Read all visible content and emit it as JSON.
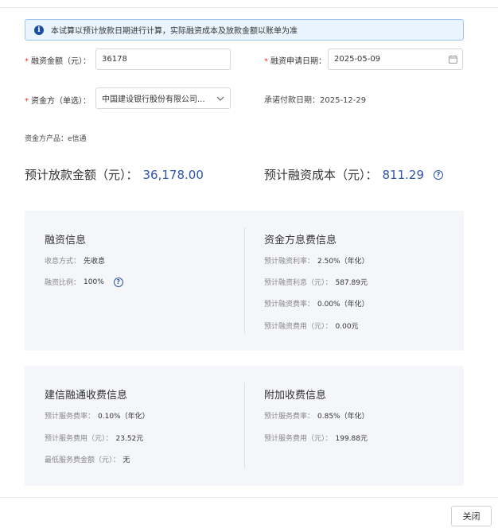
{
  "alert": {
    "text": "本试算以预计放款日期进行计算，实际融资成本及放款金额以账单为准"
  },
  "form": {
    "amount_label": "融资金额（元）：",
    "amount_value": "36178",
    "apply_date_label": "融资申请日期：",
    "apply_date_value": "2025-05-09",
    "funder_label": "资金方（单选）：",
    "funder_value": "中国建设银行股份有限公司...",
    "promise_date_label": "承诺付款日期：",
    "promise_date_value": "2025-12-29",
    "product_label": "资金方产品：",
    "product_value": "e信通"
  },
  "summary": {
    "loan_label": "预计放款金额（元）：",
    "loan_value": "36,178.00",
    "cost_label": "预计融资成本（元）：",
    "cost_value": "811.29"
  },
  "financing_info": {
    "title": "融资信息",
    "rows": [
      {
        "k": "收息方式：",
        "v": "先收息"
      },
      {
        "k": "融资比例：",
        "v": "100%"
      }
    ]
  },
  "funder_fee": {
    "title": "资金方息费信息",
    "rows": [
      {
        "k": "预计融资利率：",
        "v": "2.50%（年化）"
      },
      {
        "k": "预计融资利息（元）：",
        "v": "587.89元"
      },
      {
        "k": "预计融资费率：",
        "v": "0.00%（年化）"
      },
      {
        "k": "预计融资费用（元）：",
        "v": "0.00元"
      }
    ]
  },
  "jx_fee": {
    "title": "建信融通收费信息",
    "rows": [
      {
        "k": "预计服务费率：",
        "v": "0.10%（年化）"
      },
      {
        "k": "预计服务费用（元）：",
        "v": "23.52元"
      },
      {
        "k": "最低服务费金额（元）：",
        "v": "无"
      }
    ]
  },
  "extra_fee": {
    "title": "附加收费信息",
    "rows": [
      {
        "k": "预计服务费率：",
        "v": "0.85%（年化）"
      },
      {
        "k": "预计服务费用（元）：",
        "v": "199.88元"
      }
    ]
  },
  "footer": {
    "close_label": "关闭"
  },
  "icons": {
    "info": "i",
    "help": "?",
    "calendar": "calendar-icon",
    "chevron": "chevron-down-icon"
  }
}
